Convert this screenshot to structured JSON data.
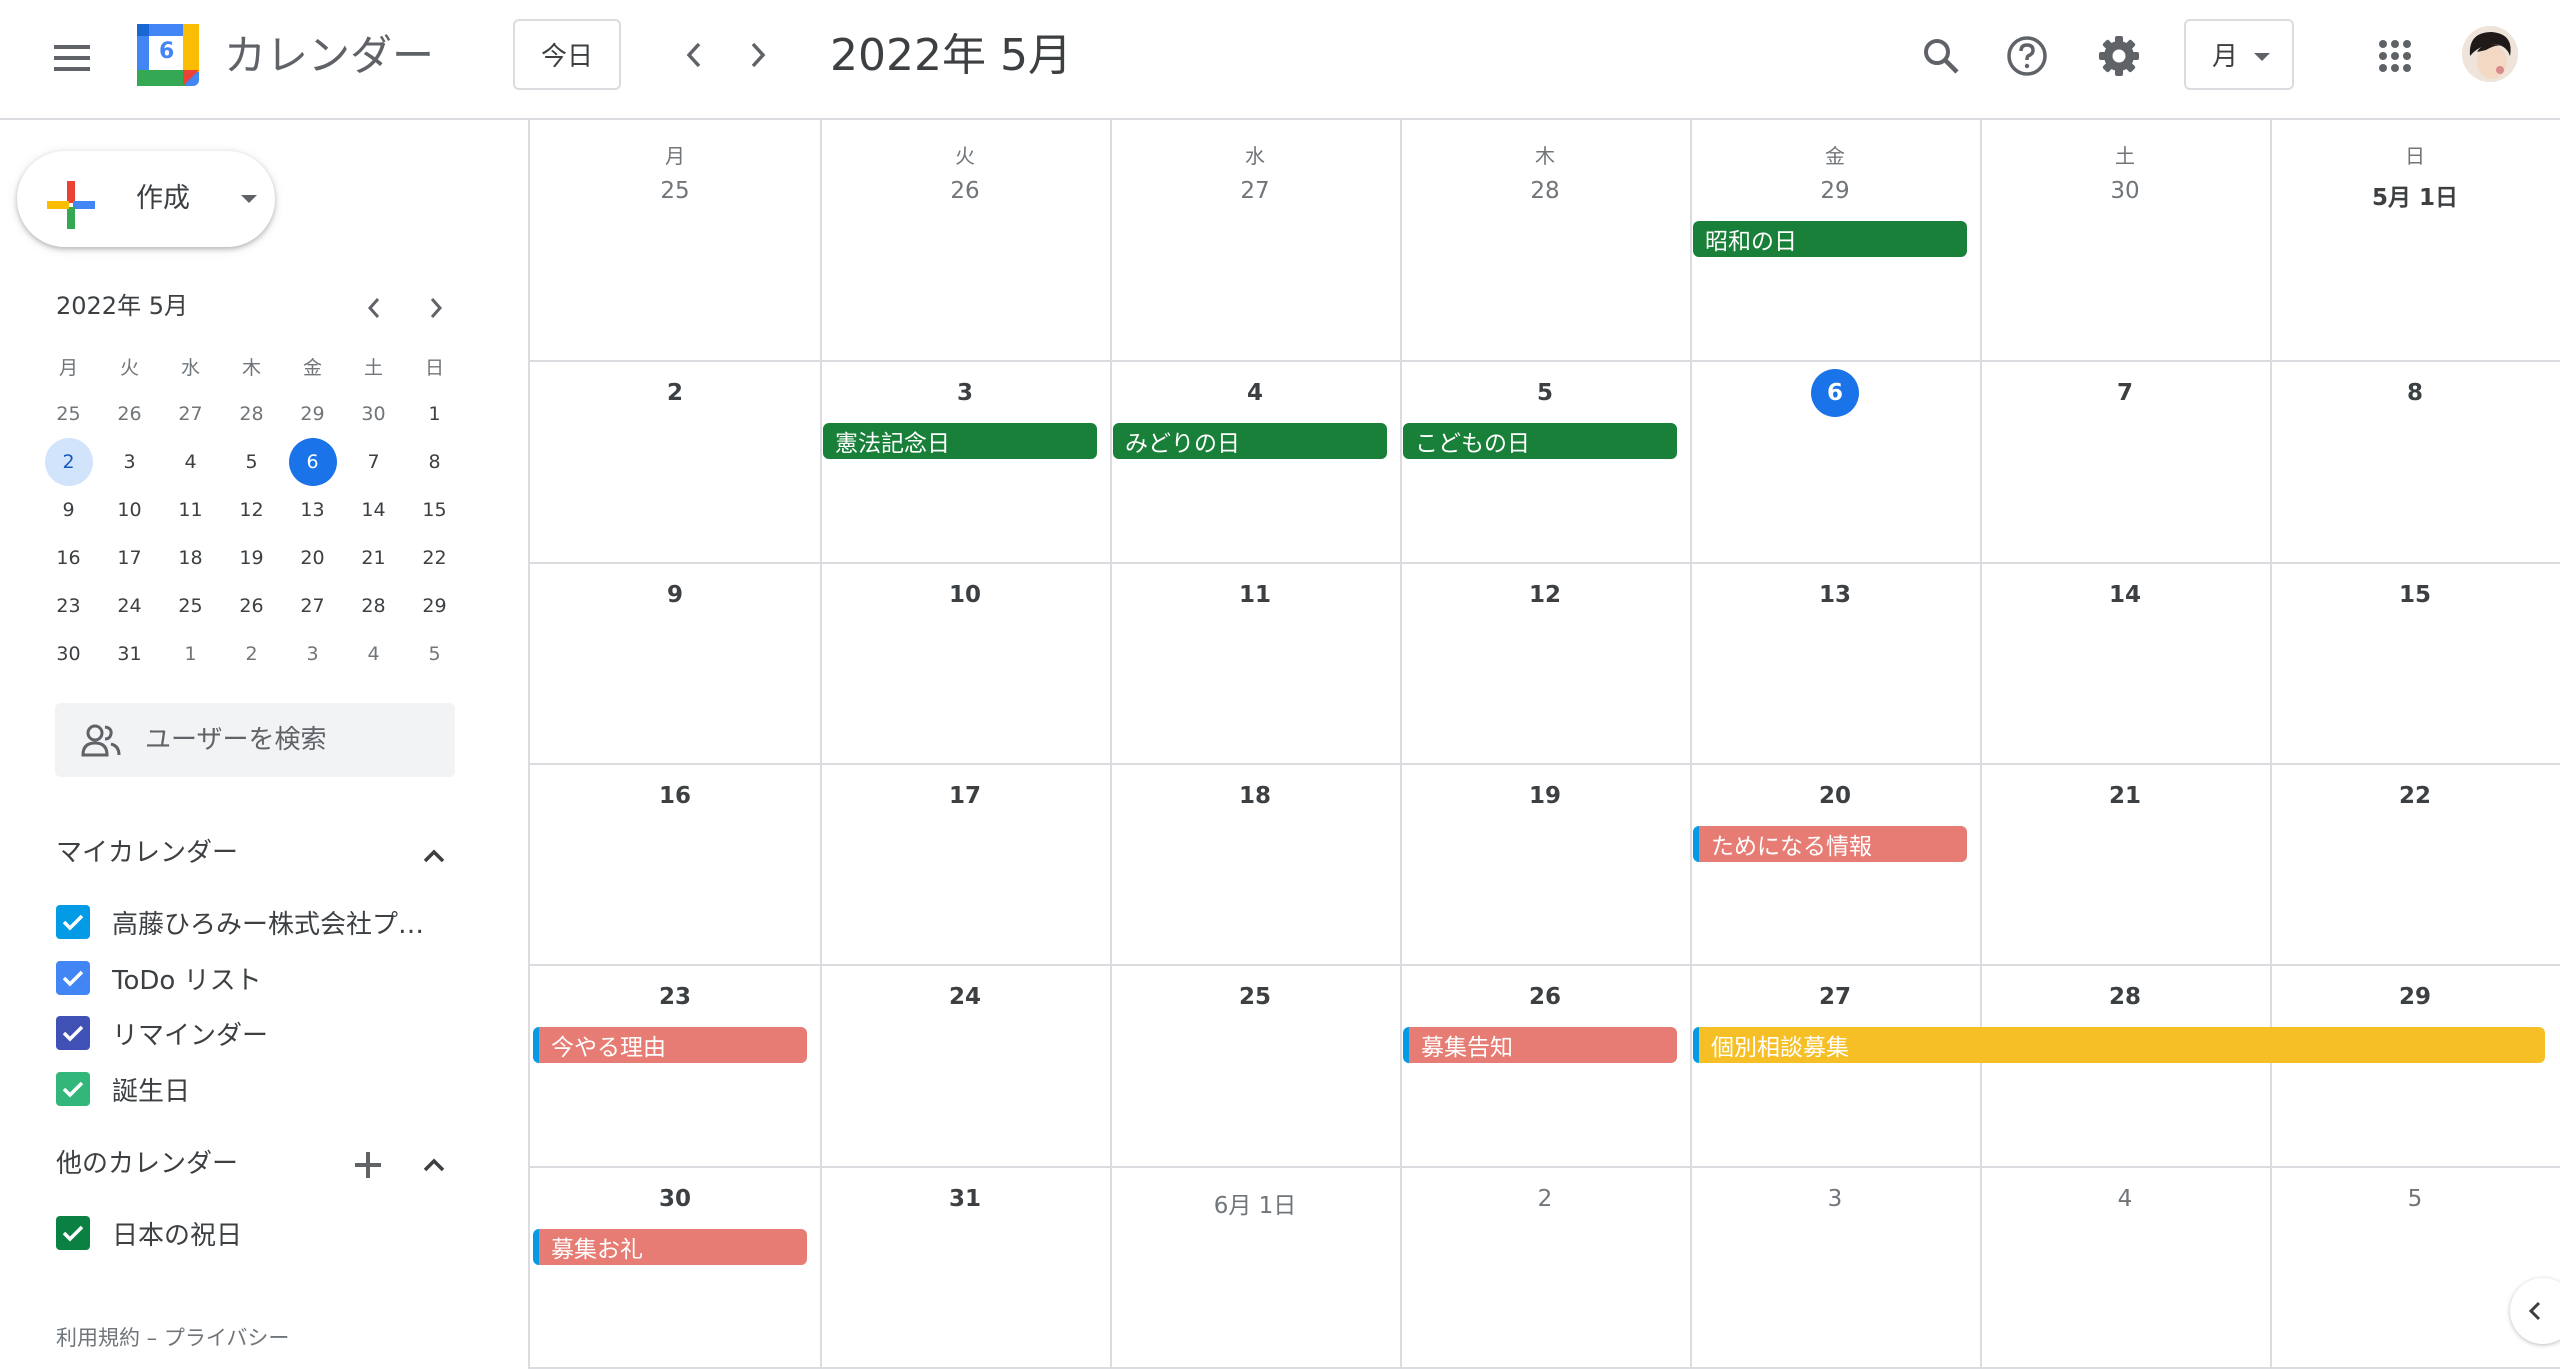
{
  "app": {
    "title": "カレンダー",
    "logo_day": "6"
  },
  "header": {
    "today_label": "今日",
    "current_period": "2022年 5月",
    "view_label": "月"
  },
  "sidebar": {
    "create_label": "作成",
    "mini": {
      "title": "2022年 5月",
      "weekdays": [
        "月",
        "火",
        "水",
        "木",
        "金",
        "土",
        "日"
      ],
      "weeks": [
        [
          "25",
          "26",
          "27",
          "28",
          "29",
          "30",
          "1"
        ],
        [
          "2",
          "3",
          "4",
          "5",
          "6",
          "7",
          "8"
        ],
        [
          "9",
          "10",
          "11",
          "12",
          "13",
          "14",
          "15"
        ],
        [
          "16",
          "17",
          "18",
          "19",
          "20",
          "21",
          "22"
        ],
        [
          "23",
          "24",
          "25",
          "26",
          "27",
          "28",
          "29"
        ],
        [
          "30",
          "31",
          "1",
          "2",
          "3",
          "4",
          "5"
        ]
      ]
    },
    "people_search_placeholder": "ユーザーを検索",
    "my_calendars": {
      "title": "マイカレンダー",
      "items": [
        {
          "label": "高藤ひろみー株式会社プ…",
          "color": "#039be5"
        },
        {
          "label": "ToDo リスト",
          "color": "#4285f4"
        },
        {
          "label": "リマインダー",
          "color": "#3f51b5"
        },
        {
          "label": "誕生日",
          "color": "#33b679"
        }
      ]
    },
    "other_calendars": {
      "title": "他のカレンダー",
      "items": [
        {
          "label": "日本の祝日",
          "color": "#0b8043"
        }
      ]
    },
    "footer": "利用規約 – プライバシー"
  },
  "month": {
    "weekdays": [
      "月",
      "火",
      "水",
      "木",
      "金",
      "土",
      "日"
    ],
    "weeks": [
      [
        "25",
        "26",
        "27",
        "28",
        "29",
        "30",
        "5月 1日"
      ],
      [
        "2",
        "3",
        "4",
        "5",
        "6",
        "7",
        "8"
      ],
      [
        "9",
        "10",
        "11",
        "12",
        "13",
        "14",
        "15"
      ],
      [
        "16",
        "17",
        "18",
        "19",
        "20",
        "21",
        "22"
      ],
      [
        "23",
        "24",
        "25",
        "26",
        "27",
        "28",
        "29"
      ],
      [
        "30",
        "31",
        "6月 1日",
        "2",
        "3",
        "4",
        "5"
      ]
    ],
    "events": {
      "showa": "昭和の日",
      "kenpo": "憲法記念日",
      "midori": "みどりの日",
      "kodomo": "こどもの日",
      "tame": "ためになる情報",
      "imayaru": "今やる理由",
      "boshu_kokuchi": "募集告知",
      "kobetsu": "個別相談募集",
      "boshu_orei": "募集お礼"
    }
  },
  "colors": {
    "accent": "#1a73e8",
    "holiday": "#188038",
    "event_red": "#e67c73",
    "event_yellow": "#f6bf26",
    "event_stripe": "#039be5"
  }
}
